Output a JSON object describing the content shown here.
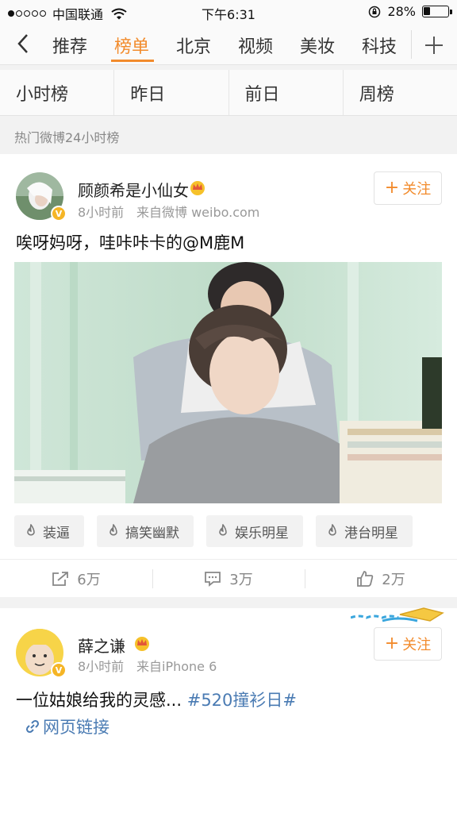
{
  "status_bar": {
    "carrier": "中国联通",
    "time": "下午6:31",
    "battery": "28%",
    "battery_level": 0.28
  },
  "top_nav": {
    "tabs": [
      "推荐",
      "榜单",
      "北京",
      "视频",
      "美妆",
      "科技"
    ],
    "active_tab": "榜单"
  },
  "sub_tabs": [
    "小时榜",
    "昨日",
    "前日",
    "周榜"
  ],
  "section_label": "热门微博24小时榜",
  "posts": [
    {
      "username": "顾颜希是小仙女",
      "time": "8小时前",
      "source": "来自微博 weibo.com",
      "follow_label": "关注",
      "text": "唉呀妈呀，哇咔咔卡的@M鹿M",
      "tags": [
        "装逼",
        "搞笑幽默",
        "娱乐明星",
        "港台明星"
      ],
      "actions": {
        "repost": "6万",
        "comment": "3万",
        "like": "2万"
      }
    },
    {
      "username": "薛之谦",
      "time": "8小时前",
      "source": "来自iPhone 6",
      "follow_label": "关注",
      "text": "一位姑娘给我的灵感...",
      "hashtag": "#520撞衫日#",
      "link_text": "网页链接"
    }
  ],
  "colors": {
    "accent": "#f28b2c",
    "link": "#4a7bb3",
    "verified": "#f5b526"
  }
}
